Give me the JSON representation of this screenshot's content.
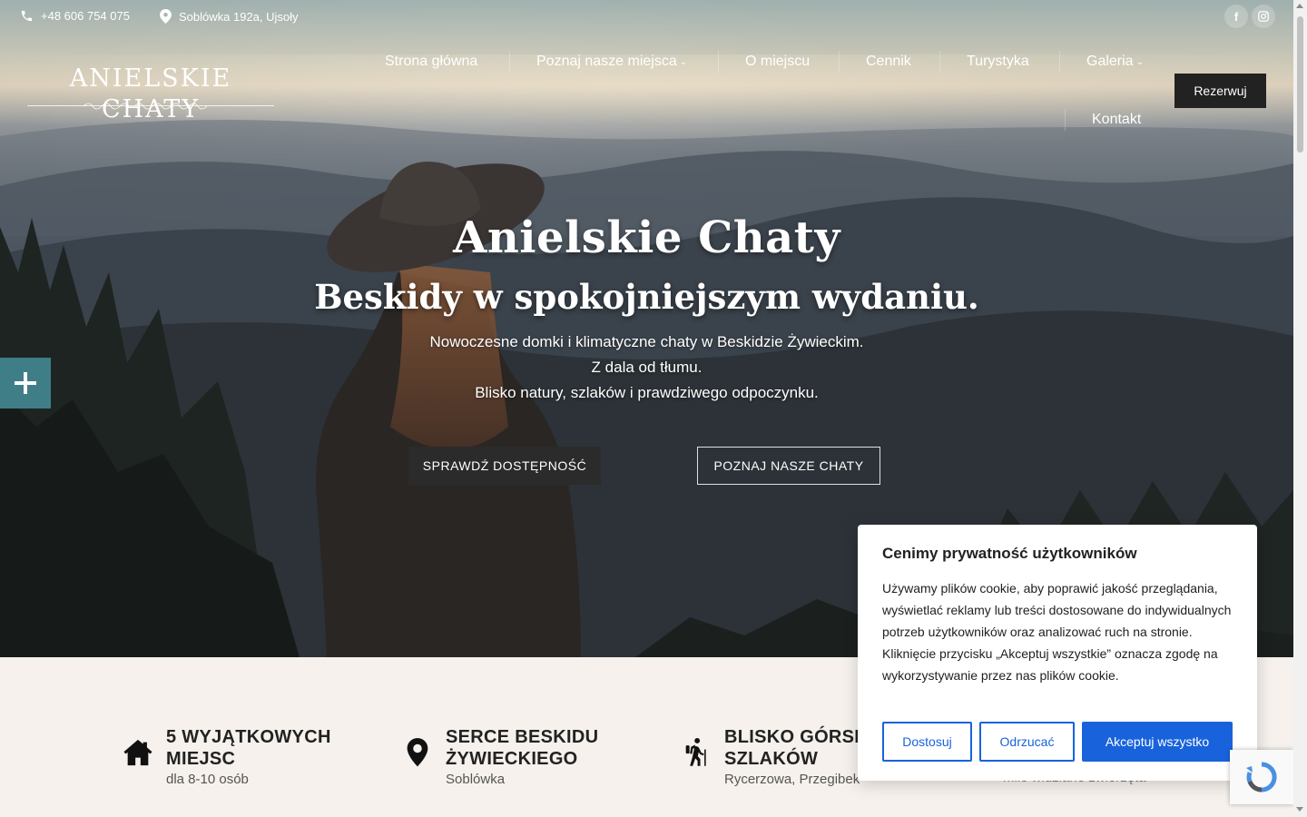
{
  "topbar": {
    "phone": "+48 606 754 075",
    "address": "Soblówka 192a, Ujsoły",
    "social": [
      "facebook-icon",
      "instagram-icon"
    ]
  },
  "logo": {
    "text": "ANIELSKIE CHATY"
  },
  "nav": {
    "items": [
      {
        "label": "Strona główna",
        "dropdown": false
      },
      {
        "label": "Poznaj nasze miejsca",
        "dropdown": true
      },
      {
        "label": "O miejscu",
        "dropdown": false
      },
      {
        "label": "Cennik",
        "dropdown": false
      },
      {
        "label": "Turystyka",
        "dropdown": false
      },
      {
        "label": "Galeria",
        "dropdown": true
      },
      {
        "label": "Kontakt",
        "dropdown": false
      }
    ],
    "cta": "Rezerwuj"
  },
  "hero": {
    "title": "Anielskie Chaty",
    "subtitle": "Beskidy w spokojniejszym wydaniu.",
    "lines": [
      "Nowoczesne domki i klimatyczne chaty w Beskidzie Żywieckim.",
      "Z dala od tłumu.",
      "Blisko natury, szlaków i prawdziwego odpoczynku."
    ],
    "btn_primary": "SPRAWDŹ DOSTĘPNOŚĆ",
    "btn_secondary": "POZNAJ NASZE CHATY"
  },
  "features": [
    {
      "icon": "house-icon",
      "title_line1": "5 WYJĄTKOWYCH",
      "title_line2": "MIEJSC",
      "sub": "dla 8-10 osób"
    },
    {
      "icon": "map-pin-icon",
      "title_line1": "SERCE BESKIDU",
      "title_line2": "ŻYWIECKIEGO",
      "sub": "Soblówka"
    },
    {
      "icon": "hiker-icon",
      "title_line1": "BLISKO GÓRSKICH",
      "title_line2": "SZLAKÓW",
      "sub": "Rycerzowa, Przegibek"
    },
    {
      "icon": "paw-icon",
      "title_line1": "",
      "title_line2": "",
      "sub": "mile widziane zwierzęta"
    }
  ],
  "cookie": {
    "title": "Cenimy prywatność użytkowników",
    "text": "Używamy plików cookie, aby poprawić jakość przeglądania, wyświetlać reklamy lub treści dostosowane do indywidualnych potrzeb użytkowników oraz analizować ruch na stronie. Kliknięcie przycisku „Akceptuj wszystkie” oznacza zgodę na wykorzystywanie przez nas plików cookie.",
    "btn_customize": "Dostosuj",
    "btn_reject": "Odrzucać",
    "btn_accept": "Akceptuj wszystko"
  },
  "colors": {
    "accent_blue": "#1863dc",
    "teal": "#3f7e87",
    "dark_button": "#222222",
    "section_bg": "#f6f1ec"
  }
}
